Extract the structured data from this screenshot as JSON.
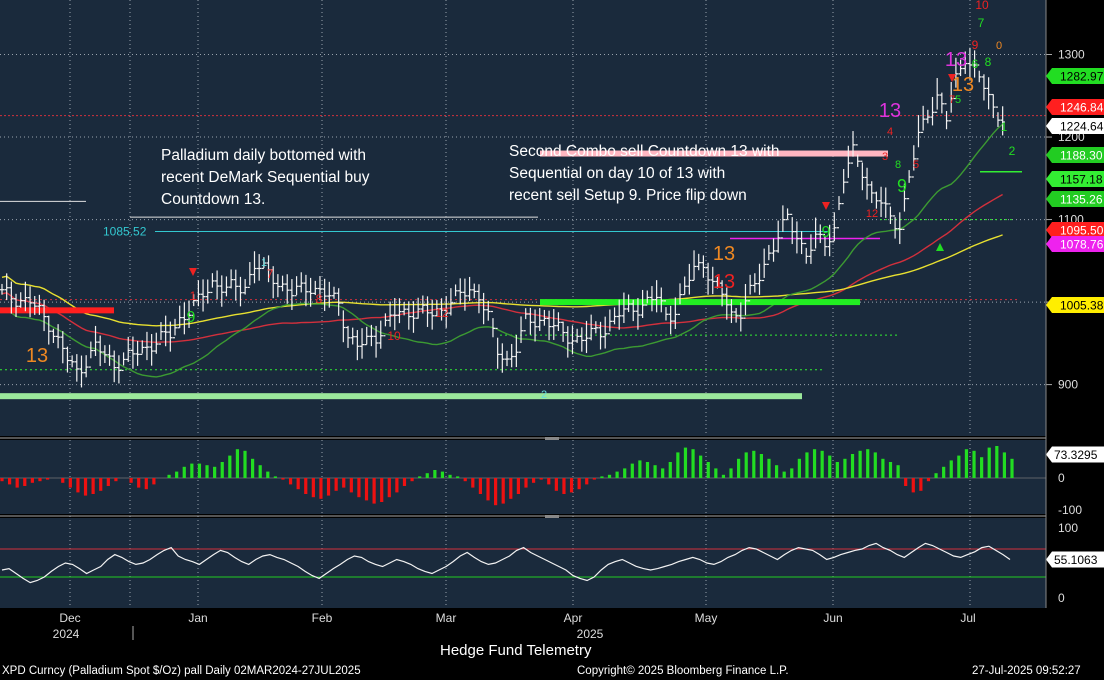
{
  "chart_data": [
    {
      "type": "candlestick",
      "instrument": "XPD Curncy (Palladium Spot $/Oz) pall",
      "period": "Daily 02MAR2024-27JUL2025",
      "ylim": [
        845,
        1360
      ],
      "x_ticks": [
        "Dec",
        "Jan",
        "Feb",
        "Mar",
        "Apr",
        "May",
        "Jun",
        "Jul"
      ],
      "x_year_labels": [
        "2024",
        "2025"
      ],
      "y_ticks": [
        900,
        1000,
        1100,
        1200,
        1300
      ],
      "price_tags": [
        {
          "value": "1282.97",
          "color": "#22dd22"
        },
        {
          "value": "1246.84",
          "color": "#ff1f1f"
        },
        {
          "value": "1224.64",
          "color": "#ffffff"
        },
        {
          "value": "1188.30",
          "color": "#22cc22"
        },
        {
          "value": "1157.18",
          "color": "#33ee33"
        },
        {
          "value": "1135.26",
          "color": "#22cc22"
        },
        {
          "value": "1095.50",
          "color": "#ff1f1f"
        },
        {
          "value": "1078.76",
          "color": "#ee22ee"
        },
        {
          "value": "1005.38",
          "color": "#ffee00"
        }
      ],
      "level_label": "1085.52",
      "close_path": [
        [
          0,
          1010
        ],
        [
          6,
          1000
        ],
        [
          10,
          975
        ],
        [
          14,
          930
        ],
        [
          16,
          915
        ],
        [
          20,
          945
        ],
        [
          24,
          925
        ],
        [
          28,
          935
        ],
        [
          32,
          950
        ],
        [
          36,
          960
        ],
        [
          38,
          980
        ],
        [
          42,
          1000
        ],
        [
          45,
          1025
        ],
        [
          48,
          1015
        ],
        [
          52,
          1020
        ],
        [
          54,
          1045
        ],
        [
          58,
          1030
        ],
        [
          62,
          1010
        ],
        [
          66,
          1020
        ],
        [
          70,
          1005
        ],
        [
          72,
          1000
        ],
        [
          74,
          960
        ],
        [
          76,
          945
        ],
        [
          80,
          960
        ],
        [
          84,
          985
        ],
        [
          88,
          990
        ],
        [
          92,
          985
        ],
        [
          96,
          1000
        ],
        [
          100,
          1015
        ],
        [
          102,
          1010
        ],
        [
          104,
          980
        ],
        [
          106,
          940
        ],
        [
          108,
          930
        ],
        [
          110,
          945
        ],
        [
          112,
          975
        ],
        [
          116,
          980
        ],
        [
          120,
          960
        ],
        [
          124,
          955
        ],
        [
          128,
          965
        ],
        [
          132,
          985
        ],
        [
          136,
          995
        ],
        [
          140,
          1005
        ],
        [
          142,
          985
        ],
        [
          144,
          990
        ],
        [
          148,
          1040
        ],
        [
          150,
          1050
        ],
        [
          152,
          1020
        ],
        [
          154,
          1010
        ],
        [
          156,
          985
        ],
        [
          158,
          990
        ],
        [
          160,
          1010
        ],
        [
          162,
          1030
        ],
        [
          164,
          1060
        ],
        [
          166,
          1080
        ],
        [
          168,
          1100
        ],
        [
          170,
          1080
        ],
        [
          172,
          1060
        ],
        [
          174,
          1075
        ],
        [
          176,
          1070
        ],
        [
          178,
          1090
        ],
        [
          180,
          1150
        ],
        [
          182,
          1180
        ],
        [
          184,
          1160
        ],
        [
          186,
          1130
        ],
        [
          188,
          1120
        ],
        [
          190,
          1100
        ],
        [
          192,
          1095
        ],
        [
          194,
          1150
        ],
        [
          196,
          1200
        ],
        [
          198,
          1230
        ],
        [
          200,
          1250
        ],
        [
          202,
          1220
        ],
        [
          204,
          1270
        ],
        [
          206,
          1300
        ],
        [
          208,
          1280
        ],
        [
          210,
          1260
        ],
        [
          212,
          1235
        ],
        [
          214,
          1224.64
        ]
      ],
      "indicator_bands": [
        {
          "level": 1180,
          "color": "#ffb6c1"
        },
        {
          "level": 1000,
          "color": "#22ee22"
        },
        {
          "level": 990,
          "color": "#ff1f1f"
        },
        {
          "level": 886,
          "color": "#9be89b"
        }
      ],
      "setup_labels": [
        {
          "t": "13",
          "color": "#ee8822"
        },
        {
          "t": "13",
          "color": "#ee8822"
        },
        {
          "t": "13",
          "color": "#ee8822"
        },
        {
          "t": "13",
          "color": "#dd33dd"
        },
        {
          "t": "13",
          "color": "#dd33dd"
        },
        {
          "t": "13",
          "color": "#ee2222"
        },
        {
          "t": "9",
          "color": "#22dd22"
        },
        {
          "t": "9",
          "color": "#22dd22"
        },
        {
          "t": "9",
          "color": "#22dd22"
        },
        {
          "t": "10",
          "color": "#ee2222"
        },
        {
          "t": "7",
          "color": "#22dd22"
        },
        {
          "t": "9",
          "color": "#ee2222"
        },
        {
          "t": "0",
          "color": "#ee8822"
        },
        {
          "t": "8",
          "color": "#22dd22"
        },
        {
          "t": "6",
          "color": "#22dd22"
        },
        {
          "t": "7",
          "color": "#ee2222"
        },
        {
          "t": "5",
          "color": "#22dd22"
        },
        {
          "t": "4",
          "color": "#ee2222"
        },
        {
          "t": "3",
          "color": "#ee2222"
        },
        {
          "t": "8",
          "color": "#22dd22"
        },
        {
          "t": "5",
          "color": "#ee2222"
        },
        {
          "t": "12",
          "color": "#ee2222"
        },
        {
          "t": "1",
          "color": "#ee2222"
        },
        {
          "t": "7",
          "color": "#ee2222"
        },
        {
          "t": "8",
          "color": "#ee2222"
        },
        {
          "t": "12",
          "color": "#ee2222"
        },
        {
          "t": "10",
          "color": "#ee2222"
        },
        {
          "t": "1",
          "color": "#66dddd"
        },
        {
          "t": "2",
          "color": "#66dddd"
        },
        {
          "t": "1",
          "color": "#22dd22"
        },
        {
          "t": "2",
          "color": "#22dd22"
        }
      ]
    },
    {
      "type": "bar",
      "name": "momentum-histogram",
      "ylim": [
        -100,
        100
      ],
      "y_ticks": [
        0,
        -100
      ],
      "value_tag": "73.3295",
      "values": [
        -10,
        -20,
        -30,
        -25,
        -15,
        -10,
        -5,
        0,
        -15,
        -30,
        -45,
        -55,
        -50,
        -40,
        -25,
        -10,
        0,
        -15,
        -30,
        -35,
        -20,
        0,
        10,
        20,
        35,
        45,
        45,
        40,
        35,
        50,
        70,
        90,
        85,
        60,
        40,
        20,
        5,
        -5,
        -20,
        -35,
        -50,
        -60,
        -65,
        -55,
        -40,
        -30,
        -45,
        -60,
        -70,
        -80,
        -75,
        -60,
        -45,
        -25,
        -10,
        5,
        15,
        25,
        20,
        10,
        5,
        -10,
        -30,
        -50,
        -70,
        -85,
        -80,
        -65,
        -50,
        -30,
        -15,
        -5,
        -20,
        -40,
        -50,
        -45,
        -35,
        -20,
        -5,
        5,
        10,
        20,
        30,
        45,
        55,
        50,
        40,
        30,
        50,
        80,
        95,
        90,
        70,
        50,
        30,
        10,
        30,
        60,
        80,
        85,
        75,
        60,
        40,
        20,
        30,
        60,
        80,
        90,
        85,
        70,
        50,
        60,
        75,
        85,
        90,
        80,
        60,
        50,
        40,
        -25,
        -45,
        -40,
        -10,
        15,
        35,
        55,
        70,
        90,
        85,
        65,
        95,
        100,
        80,
        60
      ]
    },
    {
      "type": "line",
      "name": "oscillator",
      "ylim": [
        0,
        100
      ],
      "y_ticks": [
        100,
        50,
        0
      ],
      "bands": [
        70,
        30
      ],
      "value_tag": "55.1063",
      "values": [
        40,
        42,
        35,
        28,
        22,
        25,
        30,
        38,
        45,
        50,
        48,
        42,
        35,
        40,
        45,
        55,
        62,
        58,
        52,
        48,
        50,
        55,
        62,
        68,
        72,
        60,
        55,
        52,
        48,
        55,
        62,
        68,
        65,
        58,
        52,
        48,
        55,
        60,
        62,
        58,
        55,
        50,
        45,
        38,
        32,
        28,
        35,
        42,
        48,
        55,
        60,
        58,
        52,
        48,
        45,
        50,
        55,
        52,
        48,
        42,
        38,
        35,
        40,
        45,
        52,
        60,
        65,
        58,
        52,
        48,
        50,
        55,
        60,
        68,
        72,
        65,
        60,
        55,
        50,
        45,
        40,
        32,
        28,
        25,
        30,
        40,
        48,
        52,
        55,
        50,
        45,
        42,
        40,
        42,
        45,
        48,
        52,
        55,
        58,
        55,
        50,
        48,
        52,
        58,
        62,
        68,
        72,
        70,
        65,
        60,
        55,
        62,
        68,
        72,
        70,
        68,
        62,
        55,
        58,
        62,
        65,
        68,
        70,
        75,
        78,
        72,
        68,
        62,
        58,
        65,
        72,
        78,
        75,
        70,
        65,
        60,
        58,
        62,
        66,
        72,
        74,
        68,
        62,
        55
      ]
    }
  ],
  "annotations": {
    "left": "Palladium daily bottomed with\nrecent DeMark Sequential buy\nCountdown 13.",
    "right": "Second Combo sell Countdown 13 with\nSequential on day 10 of 13 with\nrecent sell Setup 9.  Price flip down"
  },
  "footer": {
    "center": "Hedge Fund Telemetry",
    "left": "XPD Curncy (Palladium Spot  $/Oz) pall  Daily 02MAR2024-27JUL2025",
    "copyright": "Copyright© 2025 Bloomberg Finance L.P.",
    "timestamp": "27-Jul-2025 09:52:27"
  },
  "colors": {
    "panel_bg": "#1a2a3c",
    "grid": "#9aa4ae",
    "ma_red": "#d2303c",
    "ma_yellow": "#e8e030",
    "ma_green": "#3c9a32"
  }
}
